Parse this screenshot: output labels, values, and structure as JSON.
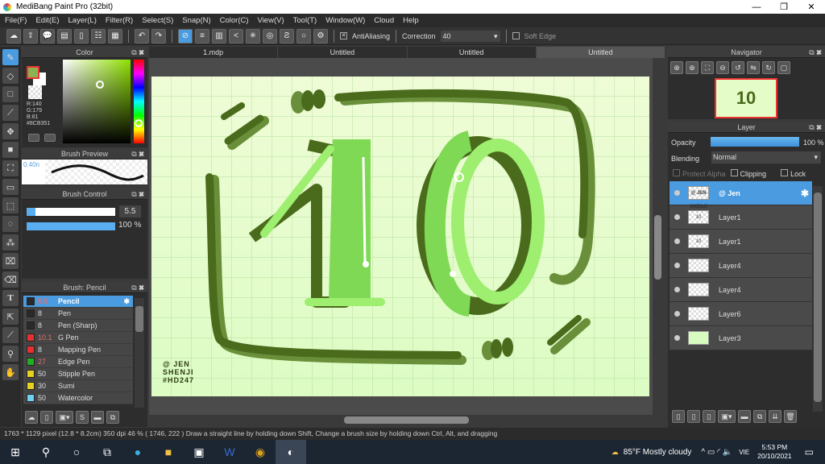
{
  "window": {
    "title": "MediBang Paint Pro (32bit)",
    "min": "—",
    "max": "❐",
    "close": "✕"
  },
  "menu": [
    "File(F)",
    "Edit(E)",
    "Layer(L)",
    "Filter(R)",
    "Select(S)",
    "Snap(N)",
    "Color(C)",
    "View(V)",
    "Tool(T)",
    "Window(W)",
    "Cloud",
    "Help"
  ],
  "toolbar": {
    "antialiasing": "AntiAliasing",
    "correction_label": "Correction",
    "correction_value": "40",
    "soft_edge": "Soft Edge"
  },
  "tabs": [
    "1.mdp",
    "Untitled",
    "Untitled",
    "Untitled"
  ],
  "color_panel": {
    "title": "Color",
    "r": "R:140",
    "g": "G:179",
    "b": "B:81",
    "hex": "#8CB351",
    "primary": "#8cb351",
    "secondary": "#ffffff"
  },
  "brush_preview": {
    "title": "Brush Preview",
    "size": "0.40n"
  },
  "brush_control": {
    "title": "Brush Control",
    "size": "5.5",
    "opacity": "100 %",
    "size_fraction": 0.1,
    "opacity_fraction": 1.0
  },
  "brush_list": {
    "title": "Brush: Pencil",
    "items": [
      {
        "size": "5.5",
        "name": "Pencil",
        "color": "#2a2a2a",
        "selected": true
      },
      {
        "size": "8",
        "name": "Pen",
        "color": "#2a2a2a"
      },
      {
        "size": "8",
        "name": "Pen (Sharp)",
        "color": "#2a2a2a"
      },
      {
        "size": "10.1",
        "name": "G Pen",
        "color": "#e83030"
      },
      {
        "size": "8",
        "name": "Mapping Pen",
        "color": "#e83030"
      },
      {
        "size": "27",
        "name": "Edge Pen",
        "color": "#20b020"
      },
      {
        "size": "50",
        "name": "Stipple Pen",
        "color": "#e8d020"
      },
      {
        "size": "30",
        "name": "Sumi",
        "color": "#e8d020"
      },
      {
        "size": "50",
        "name": "Watercolor",
        "color": "#70d0f0"
      }
    ]
  },
  "navigator": {
    "title": "Navigator"
  },
  "layer_panel": {
    "title": "Layer",
    "opacity_label": "Opacity",
    "opacity_value": "100 %",
    "blending_label": "Blending",
    "blending_value": "Normal",
    "protect_alpha": "Protect Alpha",
    "clipping": "Clipping",
    "lock": "Lock",
    "layers": [
      {
        "name": "@ Jen",
        "thumb": "@ JEN SHENJI #HD247",
        "selected": true
      },
      {
        "name": "Layer1",
        "thumb": "10"
      },
      {
        "name": "Layer1",
        "thumb": "10"
      },
      {
        "name": "Layer4",
        "thumb": ""
      },
      {
        "name": "Layer4",
        "thumb": ""
      },
      {
        "name": "Layer6",
        "thumb": ""
      },
      {
        "name": "Layer3",
        "thumb": ""
      }
    ]
  },
  "canvas": {
    "signature": [
      "@ JEN",
      "SHENJI",
      "#HD247"
    ],
    "background": "#e4fcc8",
    "accent": "#4a6b1c"
  },
  "status": "1763 * 1129 pixel   (12.8 * 8.2cm)   350 dpi   46 %   ( 1746, 222 )   Draw a straight line by holding down Shift, Change a brush size by holding down Ctrl, Alt, and dragging",
  "taskbar": {
    "weather": "85°F  Mostly cloudy",
    "lang": "VIE",
    "time": "5:53 PM",
    "date": "20/10/2021"
  }
}
